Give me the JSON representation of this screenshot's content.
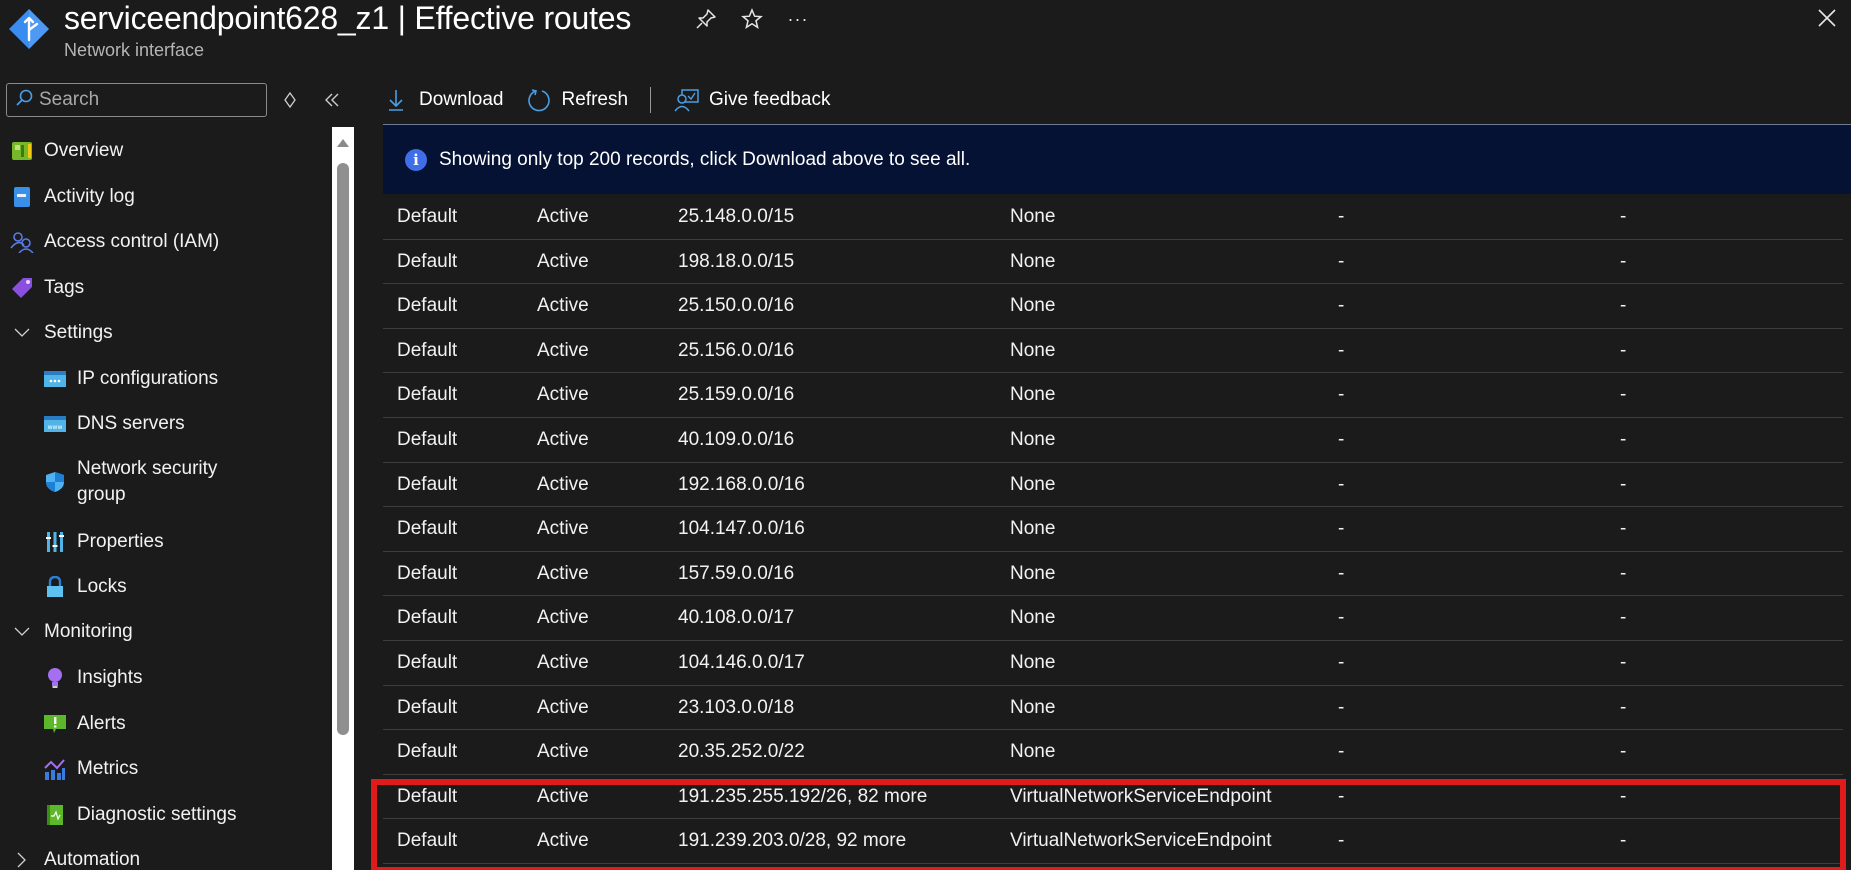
{
  "header": {
    "resource_name": "serviceendpoint628_z1",
    "separator": "|",
    "blade_title": "Effective routes",
    "title_full": "serviceendpoint628_z1 | Effective routes",
    "subtitle": "Network interface",
    "icons": [
      "pin-icon",
      "star-icon",
      "more-icon",
      "close-icon"
    ],
    "more_glyph": "···"
  },
  "sidebar": {
    "search_placeholder": "Search",
    "items": [
      {
        "label": "Overview",
        "level": 1,
        "icon": "overview-icon"
      },
      {
        "label": "Activity log",
        "level": 1,
        "icon": "activity-log-icon"
      },
      {
        "label": "Access control (IAM)",
        "level": 1,
        "icon": "iam-icon"
      },
      {
        "label": "Tags",
        "level": 1,
        "icon": "tag-icon"
      },
      {
        "label": "Settings",
        "level": 1,
        "group": true,
        "expanded": true
      },
      {
        "label": "IP configurations",
        "level": 2,
        "icon": "ip-config-icon"
      },
      {
        "label": "DNS servers",
        "level": 2,
        "icon": "dns-icon"
      },
      {
        "label": "Network security group",
        "level": 2,
        "icon": "shield-icon"
      },
      {
        "label": "Properties",
        "level": 2,
        "icon": "properties-icon"
      },
      {
        "label": "Locks",
        "level": 2,
        "icon": "lock-icon"
      },
      {
        "label": "Monitoring",
        "level": 1,
        "group": true,
        "expanded": true
      },
      {
        "label": "Insights",
        "level": 2,
        "icon": "lightbulb-icon"
      },
      {
        "label": "Alerts",
        "level": 2,
        "icon": "alert-icon"
      },
      {
        "label": "Metrics",
        "level": 2,
        "icon": "metrics-icon"
      },
      {
        "label": "Diagnostic settings",
        "level": 2,
        "icon": "diagnostic-icon"
      },
      {
        "label": "Automation",
        "level": 1,
        "group": true,
        "expanded": false
      }
    ]
  },
  "toolbar": {
    "download_label": "Download",
    "refresh_label": "Refresh",
    "feedback_label": "Give feedback"
  },
  "banner": {
    "message": "Showing only top 200 records, click Download above to see all."
  },
  "routes": {
    "rows": [
      [
        "Default",
        "Active",
        "25.148.0.0/15",
        "None",
        "-",
        "-"
      ],
      [
        "Default",
        "Active",
        "198.18.0.0/15",
        "None",
        "-",
        "-"
      ],
      [
        "Default",
        "Active",
        "25.150.0.0/16",
        "None",
        "-",
        "-"
      ],
      [
        "Default",
        "Active",
        "25.156.0.0/16",
        "None",
        "-",
        "-"
      ],
      [
        "Default",
        "Active",
        "25.159.0.0/16",
        "None",
        "-",
        "-"
      ],
      [
        "Default",
        "Active",
        "40.109.0.0/16",
        "None",
        "-",
        "-"
      ],
      [
        "Default",
        "Active",
        "192.168.0.0/16",
        "None",
        "-",
        "-"
      ],
      [
        "Default",
        "Active",
        "104.147.0.0/16",
        "None",
        "-",
        "-"
      ],
      [
        "Default",
        "Active",
        "157.59.0.0/16",
        "None",
        "-",
        "-"
      ],
      [
        "Default",
        "Active",
        "40.108.0.0/17",
        "None",
        "-",
        "-"
      ],
      [
        "Default",
        "Active",
        "104.146.0.0/17",
        "None",
        "-",
        "-"
      ],
      [
        "Default",
        "Active",
        "23.103.0.0/18",
        "None",
        "-",
        "-"
      ],
      [
        "Default",
        "Active",
        "20.35.252.0/22",
        "None",
        "-",
        "-"
      ],
      [
        "Default",
        "Active",
        "191.235.255.192/26, 82 more",
        "VirtualNetworkServiceEndpoint",
        "-",
        "-"
      ],
      [
        "Default",
        "Active",
        "191.239.203.0/28, 92 more",
        "VirtualNetworkServiceEndpoint",
        "-",
        "-"
      ]
    ],
    "highlighted_rows": [
      13,
      14
    ],
    "highlight_color": "#e01b1b"
  },
  "colors": {
    "background": "#1b1b1b",
    "banner_bg": "#051233",
    "info_icon": "#3f6ee8",
    "accent_blue": "#4aa0e6"
  }
}
